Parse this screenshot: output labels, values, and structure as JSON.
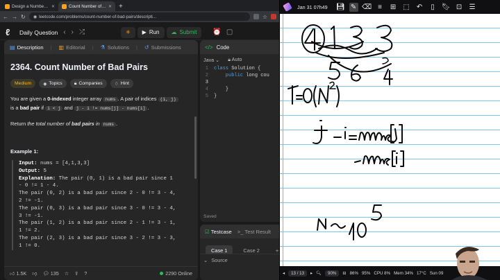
{
  "browser": {
    "tabs": [
      {
        "label": "Design a Number Container Sy",
        "active": false
      },
      {
        "label": "Count Number of Bad Pairs",
        "active": true
      }
    ],
    "url": "leetcode.com/problems/count-number-of-bad-pairs/descripti..."
  },
  "leetcode": {
    "nav_title": "Daily Question",
    "run_label": "Run",
    "submit_label": "Submit",
    "desc_tabs": [
      "Description",
      "Editorial",
      "Solutions",
      "Submissions"
    ],
    "problem_title": "2364. Count Number of Bad Pairs",
    "chips": {
      "difficulty": "Medium",
      "topics": "Topics",
      "companies": "Companies",
      "hint": "Hint"
    },
    "statement": {
      "p1_a": "You are given a ",
      "p1_b": "0-indexed",
      "p1_c": " integer array ",
      "p1_code1": "nums",
      "p1_d": ". A pair of indices ",
      "p1_code2": "(i, j)",
      "p1_e": "is a ",
      "p1_f": "bad pair",
      "p1_g": " if ",
      "p1_code3": "i < j",
      "p1_h": " and ",
      "p1_code4": "j - i != nums[j] - nums[i]",
      "p1_i": ".",
      "p2_a": "Return ",
      "p2_b": "the total number of ",
      "p2_c": "bad pairs",
      "p2_d": " in ",
      "p2_code": "nums",
      "p2_e": "."
    },
    "example_heading": "Example 1:",
    "example": {
      "input_label": "Input:",
      "input_value": " nums = [4,1,3,3]",
      "output_label": "Output:",
      "output_value": " 5",
      "explanation_label": "Explanation:",
      "explanation_lines": [
        " The pair (0, 1) is a bad pair since 1",
        "- 0 != 1 - 4.",
        "The pair (0, 2) is a bad pair since 2 - 0 != 3 - 4,",
        "2 != -1.",
        "The pair (0, 3) is a bad pair since 3 - 0 != 3 - 4,",
        "3 != -1.",
        "The pair (1, 2) is a bad pair since 2 - 1 != 3 - 1,",
        "1 != 2.",
        "The pair (2, 3) is a bad pair since 3 - 2 != 3 - 3,",
        "1 != 0."
      ]
    },
    "footer": {
      "likes": "1.5K",
      "comments": "135",
      "online": "2290 Online"
    },
    "code_panel": {
      "title": "Code",
      "language": "Java",
      "mode": "Auto",
      "lines": [
        {
          "n": "1",
          "kw": "class",
          "rest": " Solution {"
        },
        {
          "n": "2",
          "kw": "    public",
          "rest": " long cou"
        },
        {
          "n": "3",
          "kw": "",
          "rest": "        "
        },
        {
          "n": "4",
          "kw": "",
          "rest": "    }"
        },
        {
          "n": "5",
          "kw": "",
          "rest": "}"
        }
      ],
      "saved": "Saved"
    },
    "test_panel": {
      "testcase_tab": "Testcase",
      "result_tab": "Test Result",
      "cases": [
        "Case 1",
        "Case 2"
      ],
      "source": "Source"
    }
  },
  "drawing_app": {
    "date": "Jan 31 07h49",
    "status": {
      "pages": "13 / 13",
      "zoom": "90%",
      "battery": "86%",
      "volume": "95%",
      "cpu": "CPU 8%",
      "mem": "Mem 34%",
      "temp": "17°C",
      "clock": "Sun 09"
    },
    "handwriting": [
      "4 1 3 3",
      "4",
      "5",
      "6",
      "3",
      "T=O(N²)",
      "j - i = nums[j]",
      "- nums[i]",
      "N ~ 10⁵"
    ]
  },
  "colors": {
    "accent_green": "#2cbb5d",
    "medium_yellow": "#ffb800",
    "leetcode_orange": "#ffa116"
  }
}
